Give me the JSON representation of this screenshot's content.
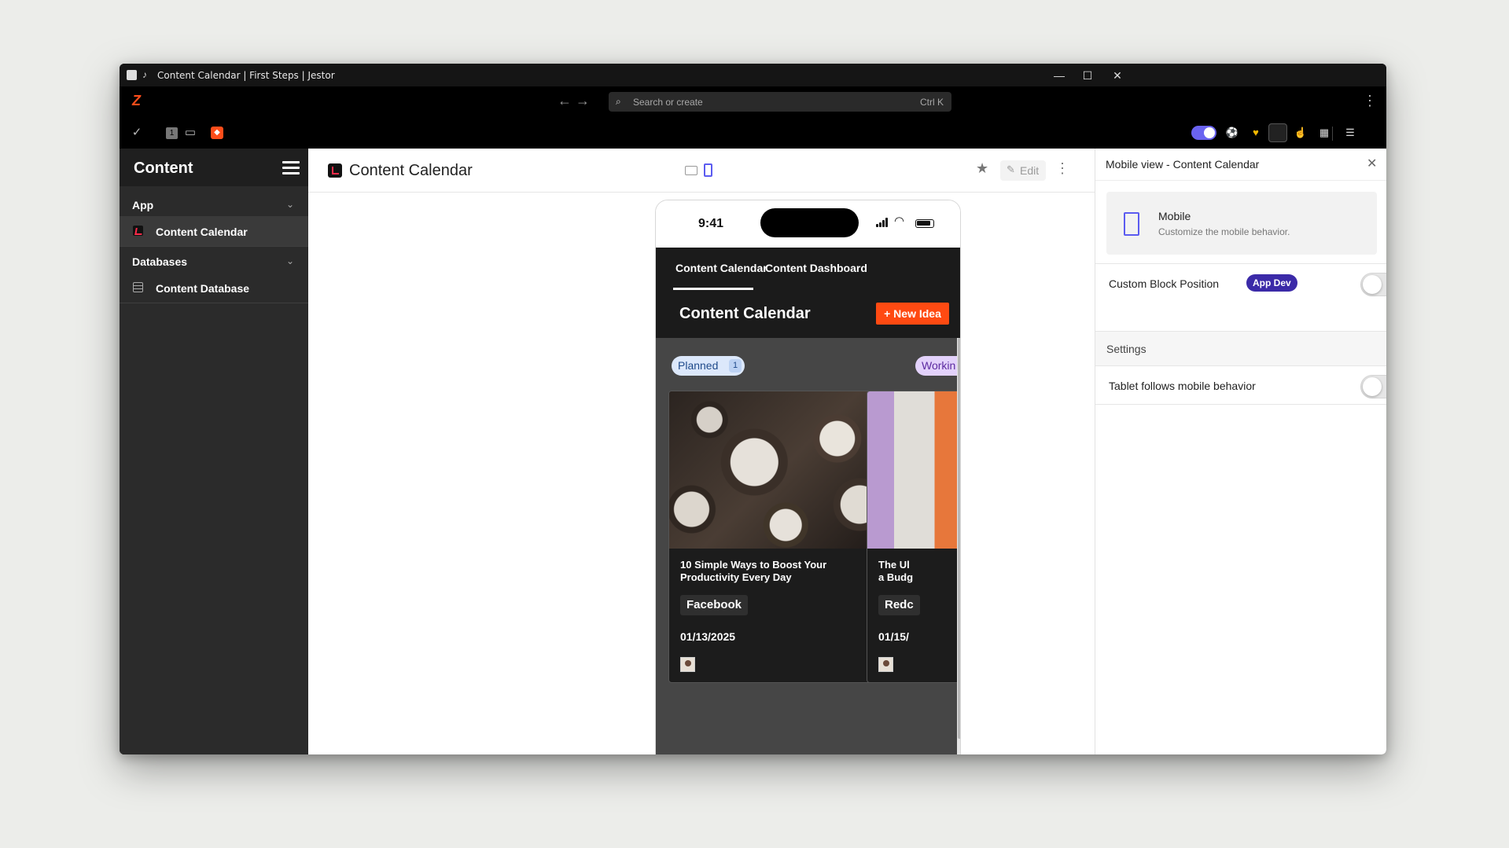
{
  "window": {
    "title": "Content Calendar | First Steps | Jestor",
    "minimize_icon": "—",
    "maximize_icon": "☐",
    "close_icon": "✕"
  },
  "browser": {
    "search_placeholder": "Search or create",
    "search_shortcut": "Ctrl K",
    "toolbar_badge_number": "1"
  },
  "sidebar": {
    "title": "Content",
    "sections": [
      {
        "label": "App",
        "items": [
          {
            "label": "Content Calendar",
            "active": true
          }
        ]
      },
      {
        "label": "Databases",
        "items": [
          {
            "label": "Content Database",
            "active": false
          }
        ]
      }
    ]
  },
  "main": {
    "title": "Content Calendar",
    "edit_label": "Edit"
  },
  "phone": {
    "time": "9:41",
    "tabs": [
      "Content Calendar",
      "Content Dashboard"
    ],
    "page_title": "Content Calendar",
    "new_button": "+ New Idea",
    "columns": [
      {
        "name": "Planned",
        "count": "1",
        "cards": [
          {
            "title": "10 Simple Ways to Boost Your Productivity Every Day",
            "tag": "Facebook",
            "date": "01/13/2025"
          }
        ]
      },
      {
        "name": "Workin",
        "count": "",
        "cards": [
          {
            "title": "The Ul\na Budg",
            "tag": "Redc",
            "date": "01/15/"
          }
        ]
      }
    ]
  },
  "panel": {
    "title": "Mobile view - Content Calendar",
    "mobile_title": "Mobile",
    "mobile_subtitle": "Customize the mobile behavior.",
    "custom_block_label": "Custom Block Position",
    "badge": "App Dev",
    "custom_block_enabled": false,
    "settings_label": "Settings",
    "tablet_label": "Tablet follows mobile behavior",
    "tablet_enabled": false
  },
  "colors": {
    "accent": "#ff4a12",
    "brand_purple": "#5b5bf0",
    "badge_purple": "#3b2aa8",
    "sidebar_bg": "#2b2b2b"
  }
}
